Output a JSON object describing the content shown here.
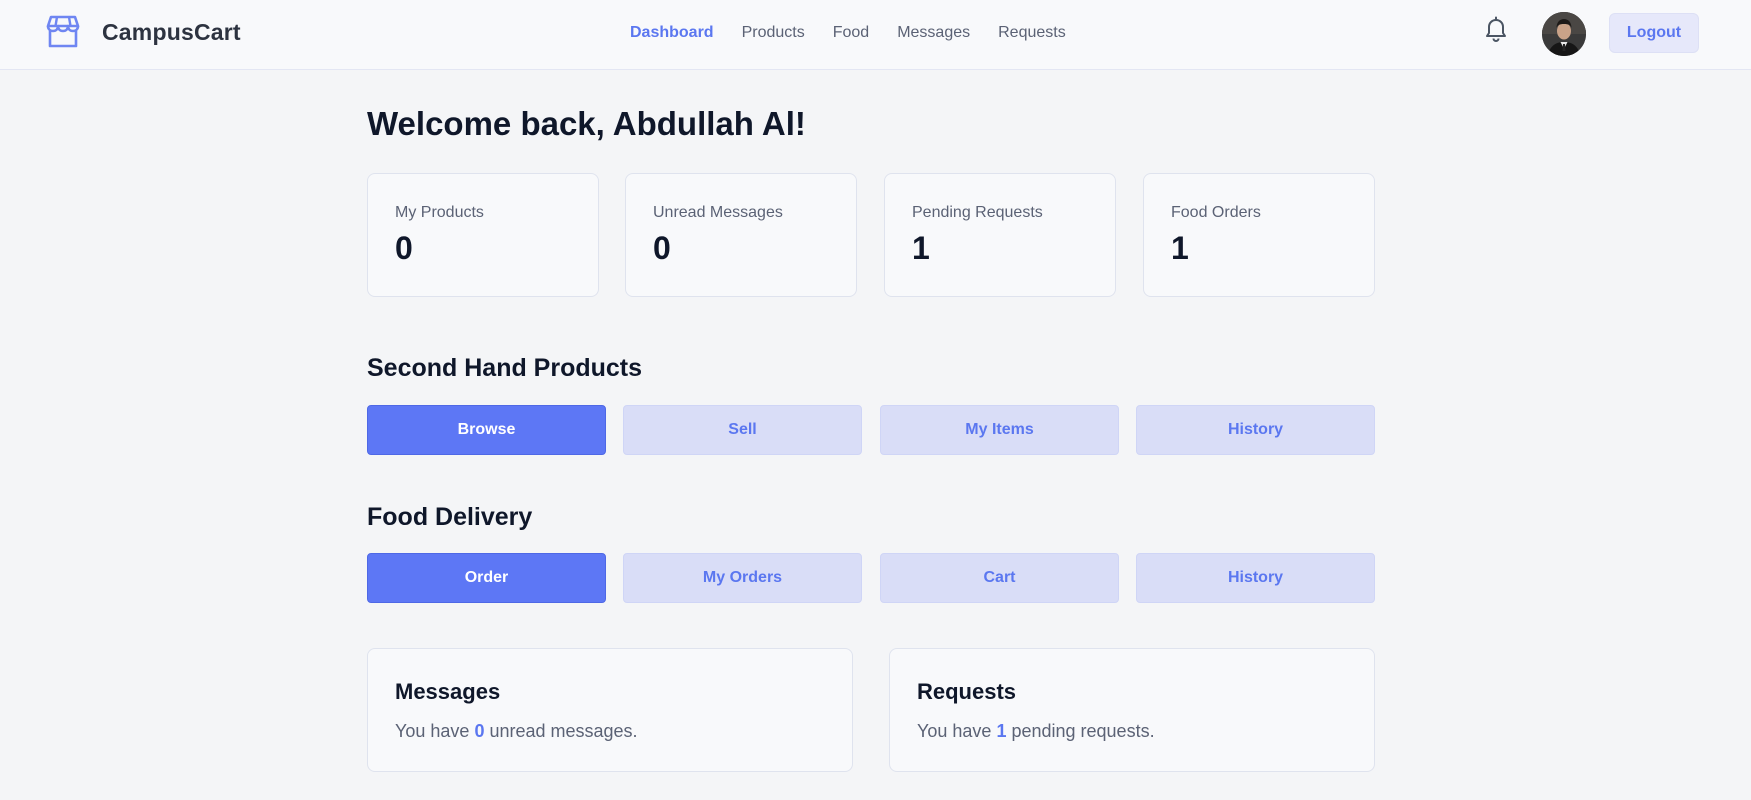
{
  "header": {
    "brand": "CampusCart",
    "nav": [
      "Dashboard",
      "Products",
      "Food",
      "Messages",
      "Requests"
    ],
    "active_nav": "Dashboard",
    "logout_label": "Logout"
  },
  "main": {
    "welcome": "Welcome back, Abdullah Al!",
    "stats": [
      {
        "label": "My Products",
        "value": "0"
      },
      {
        "label": "Unread Messages",
        "value": "0"
      },
      {
        "label": "Pending Requests",
        "value": "1"
      },
      {
        "label": "Food Orders",
        "value": "1"
      }
    ],
    "second_hand": {
      "title": "Second Hand Products",
      "buttons": [
        "Browse",
        "Sell",
        "My Items",
        "History"
      ]
    },
    "food": {
      "title": "Food Delivery",
      "buttons": [
        "Order",
        "My Orders",
        "Cart",
        "History"
      ]
    },
    "messages_card": {
      "title": "Messages",
      "prefix": "You have",
      "count": "0",
      "suffix": "unread messages."
    },
    "requests_card": {
      "title": "Requests",
      "prefix": "You have",
      "count": "1",
      "suffix": "pending requests."
    }
  },
  "colors": {
    "accent": "#5d77f5",
    "accent_light": "#d9ddf7",
    "background": "#f4f5f7"
  },
  "icons": {
    "brand": "storefront-icon",
    "notifications": "bell-icon",
    "avatar": "user-avatar"
  }
}
